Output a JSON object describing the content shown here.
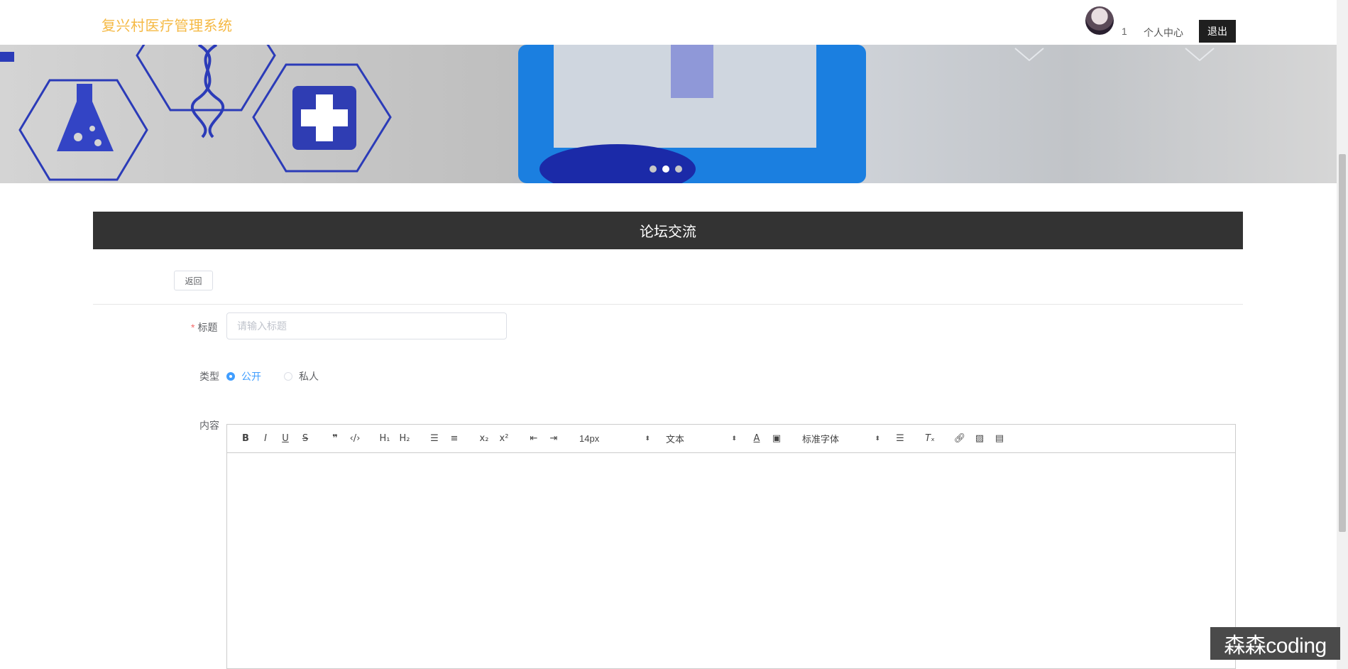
{
  "header": {
    "brand": "复兴村医疗管理系统",
    "username": "1",
    "center_label": "个人中心",
    "logout_label": "退出"
  },
  "banner": {
    "slide_count": 3,
    "active_slide": 2
  },
  "section": {
    "title": "论坛交流"
  },
  "form": {
    "back_label": "返回",
    "title_label": "标题",
    "title_placeholder": "请输入标题",
    "title_value": "",
    "type_label": "类型",
    "type_options": [
      "公开",
      "私人"
    ],
    "type_selected": "公开",
    "content_label": "内容"
  },
  "editor": {
    "font_size": "14px",
    "header_select": "文本",
    "font_family": "标准字体",
    "content": ""
  },
  "watermark": "森森coding",
  "colors": {
    "brand": "#f5b944",
    "section_bar": "#333333",
    "accent": "#409eff",
    "required": "#f56c6c"
  }
}
